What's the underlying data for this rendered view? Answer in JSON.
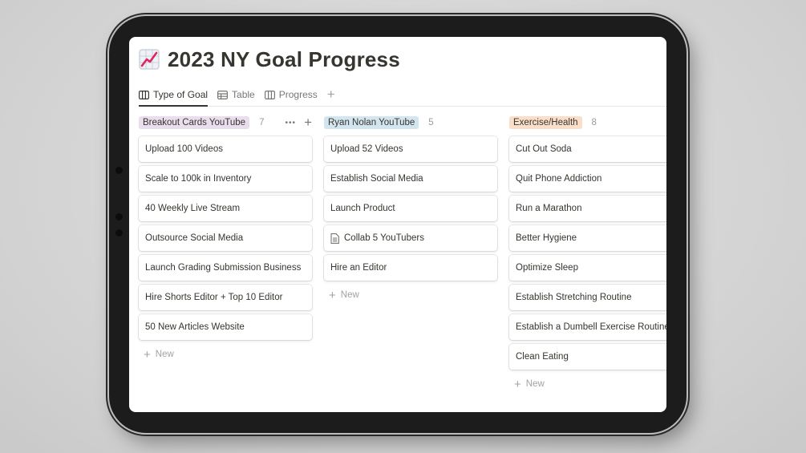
{
  "page": {
    "title": "2023 NY Goal Progress",
    "icon": "chart-increasing-icon"
  },
  "tabs": [
    {
      "label": "Type of Goal",
      "icon": "board-icon",
      "active": true
    },
    {
      "label": "Table",
      "icon": "table-icon",
      "active": false
    },
    {
      "label": "Progress",
      "icon": "board-icon",
      "active": false
    }
  ],
  "add_view_label": "+",
  "columns": [
    {
      "name": "Breakout Cards YouTube",
      "count": "7",
      "color": "#e8deee",
      "cards": [
        "Upload 100 Videos",
        "Scale to 100k in Inventory",
        "40 Weekly Live Stream",
        "Outsource Social Media",
        "Launch Grading Submission Business",
        "Hire Shorts Editor + Top 10 Editor",
        "50 New Articles Website"
      ],
      "new_label": "New"
    },
    {
      "name": "Ryan Nolan YouTube",
      "count": "5",
      "color": "#d3e5ef",
      "cards": [
        "Upload 52 Videos",
        "Establish Social Media",
        "Launch Product",
        "Collab 5 YouTubers",
        "Hire an Editor"
      ],
      "new_label": "New"
    },
    {
      "name": "Exercise/Health",
      "count": "8",
      "color": "#fadec9",
      "cards": [
        "Cut Out Soda",
        "Quit Phone Addiction",
        "Run a Marathon",
        "Better Hygiene",
        "Optimize Sleep",
        "Establish Stretching Routine",
        "Establish a Dumbell Exercise Routine",
        "Clean Eating"
      ],
      "new_label": "New"
    }
  ],
  "column_actions": {
    "more": "•••",
    "add": "+"
  }
}
